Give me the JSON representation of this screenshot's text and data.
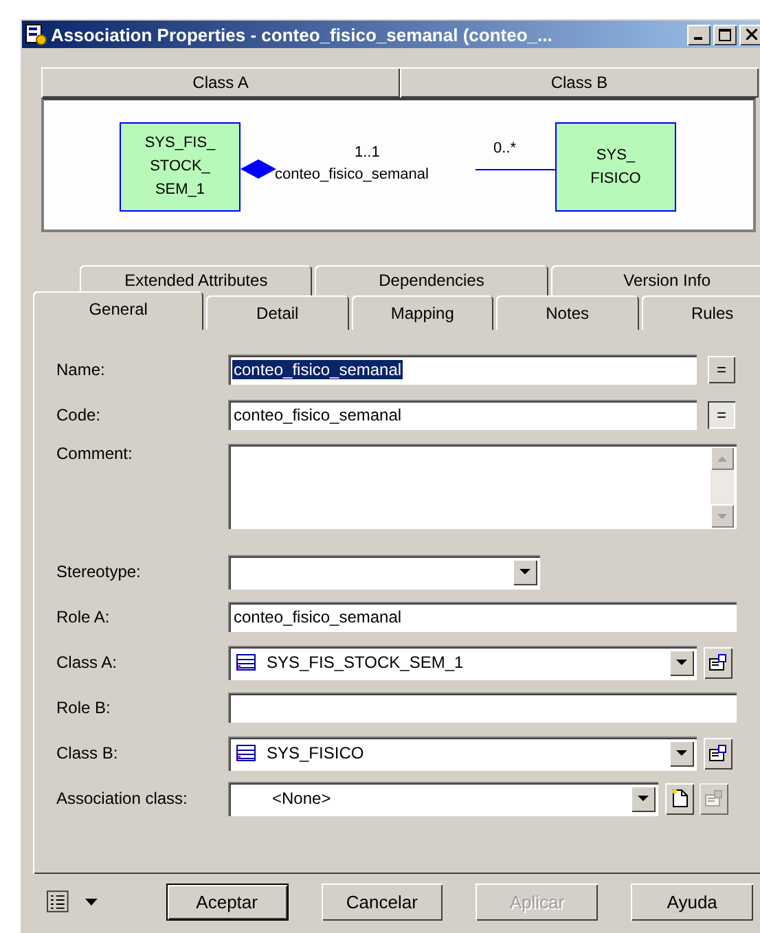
{
  "window": {
    "title": "Association Properties - conteo_fisico_semanal (conteo_..."
  },
  "header_tabs": [
    "Class A",
    "Class B"
  ],
  "diagram": {
    "class_a": [
      "SYS_FIS_",
      "STOCK_",
      "SEM_1"
    ],
    "class_b": [
      "SYS_",
      "FISICO"
    ],
    "multiplicity_a": "1..1",
    "multiplicity_b": "0..*",
    "association_name": "conteo_fisico_semanal"
  },
  "tab_rows": [
    [
      {
        "label": "Extended Attributes",
        "selected": false
      },
      {
        "label": "Dependencies",
        "selected": false
      },
      {
        "label": "Version Info",
        "selected": false
      }
    ],
    [
      {
        "label": "General",
        "selected": true
      },
      {
        "label": "Detail",
        "selected": false
      },
      {
        "label": "Mapping",
        "selected": false
      },
      {
        "label": "Notes",
        "selected": false
      },
      {
        "label": "Rules",
        "selected": false
      }
    ]
  ],
  "fields": [
    {
      "kind": "text",
      "label": "Name:",
      "value": "conteo_fisico_semanal",
      "highlighted": true,
      "equals_button": {
        "label": "=",
        "pressed": false
      }
    },
    {
      "kind": "text",
      "label": "Code:",
      "value": "conteo_fisico_semanal",
      "equals_button": {
        "label": "=",
        "pressed": true
      }
    },
    {
      "kind": "memo",
      "label": "Comment:"
    },
    {
      "kind": "combo",
      "label": "Stereotype:"
    },
    {
      "kind": "text",
      "label": "Role A:",
      "value": "conteo_fisico_semanal"
    },
    {
      "kind": "combo",
      "label": "Class A:",
      "value": "SYS_FIS_STOCK_SEM_1",
      "class_icon": true,
      "side_buttons": [
        {
          "kind": "properties",
          "disabled": false
        }
      ]
    },
    {
      "kind": "text",
      "label": "Role B:"
    },
    {
      "kind": "combo",
      "label": "Class B:",
      "value": "SYS_FISICO",
      "class_icon": true,
      "side_buttons": [
        {
          "kind": "properties",
          "disabled": false
        }
      ]
    },
    {
      "kind": "combo",
      "label": "Association class:",
      "value": "<None>",
      "class_icon": false,
      "side_buttons": [
        {
          "kind": "new",
          "disabled": false
        },
        {
          "kind": "properties",
          "disabled": true
        }
      ]
    }
  ],
  "buttons": [
    {
      "label": "Aceptar",
      "default": true,
      "disabled": false
    },
    {
      "label": "Cancelar",
      "default": false,
      "disabled": false
    },
    {
      "label": "Aplicar",
      "default": false,
      "disabled": true
    },
    {
      "label": "Ayuda",
      "default": false,
      "disabled": false
    }
  ]
}
